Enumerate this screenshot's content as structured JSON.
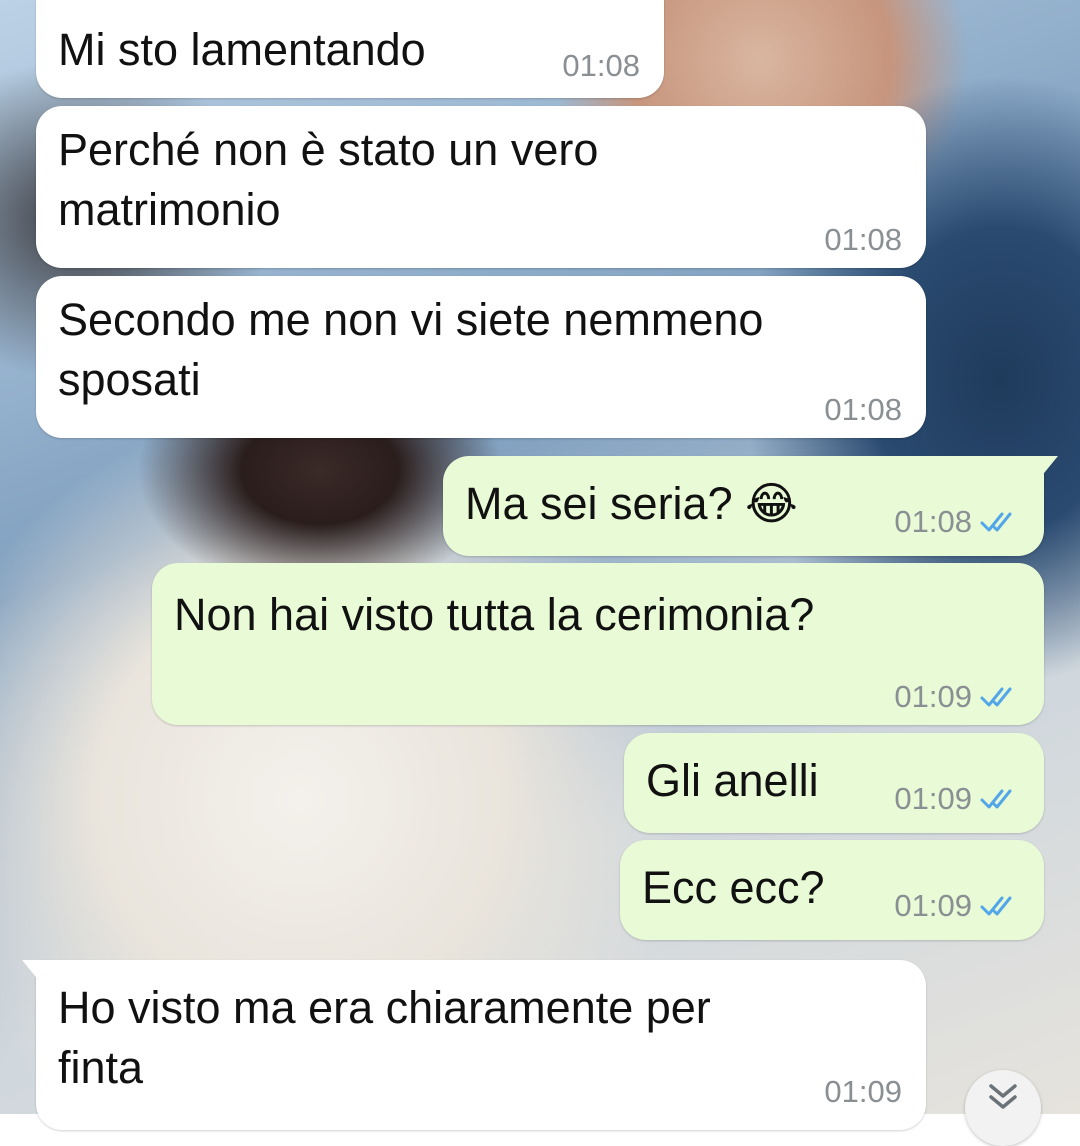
{
  "messages": [
    {
      "direction": "incoming",
      "text": "Mi sto lamentando",
      "time": "01:08"
    },
    {
      "direction": "incoming",
      "text": "Perché non è stato un vero\nmatrimonio",
      "time": "01:08"
    },
    {
      "direction": "incoming",
      "text": "Secondo me non vi siete nemmeno\nsposati",
      "time": "01:08"
    },
    {
      "direction": "outgoing",
      "text": "Ma sei seria? 😂",
      "time": "01:08",
      "read": true
    },
    {
      "direction": "outgoing",
      "text": "Non hai visto tutta la cerimonia?",
      "time": "01:09",
      "read": true
    },
    {
      "direction": "outgoing",
      "text": "Gli anelli",
      "time": "01:09",
      "read": true
    },
    {
      "direction": "outgoing",
      "text": "Ecc ecc?",
      "time": "01:09",
      "read": true
    },
    {
      "direction": "incoming",
      "text": "Ho visto ma era chiaramente per\nfinta",
      "time": "01:09"
    }
  ],
  "colors": {
    "incoming_bubble": "#ffffff",
    "outgoing_bubble": "#e8fbd6",
    "timestamp": "#8a8f93",
    "read_ticks": "#53a6e8"
  },
  "icons": {
    "read_receipt": "double-check-icon",
    "scroll_down": "double-chevron-down-icon"
  }
}
